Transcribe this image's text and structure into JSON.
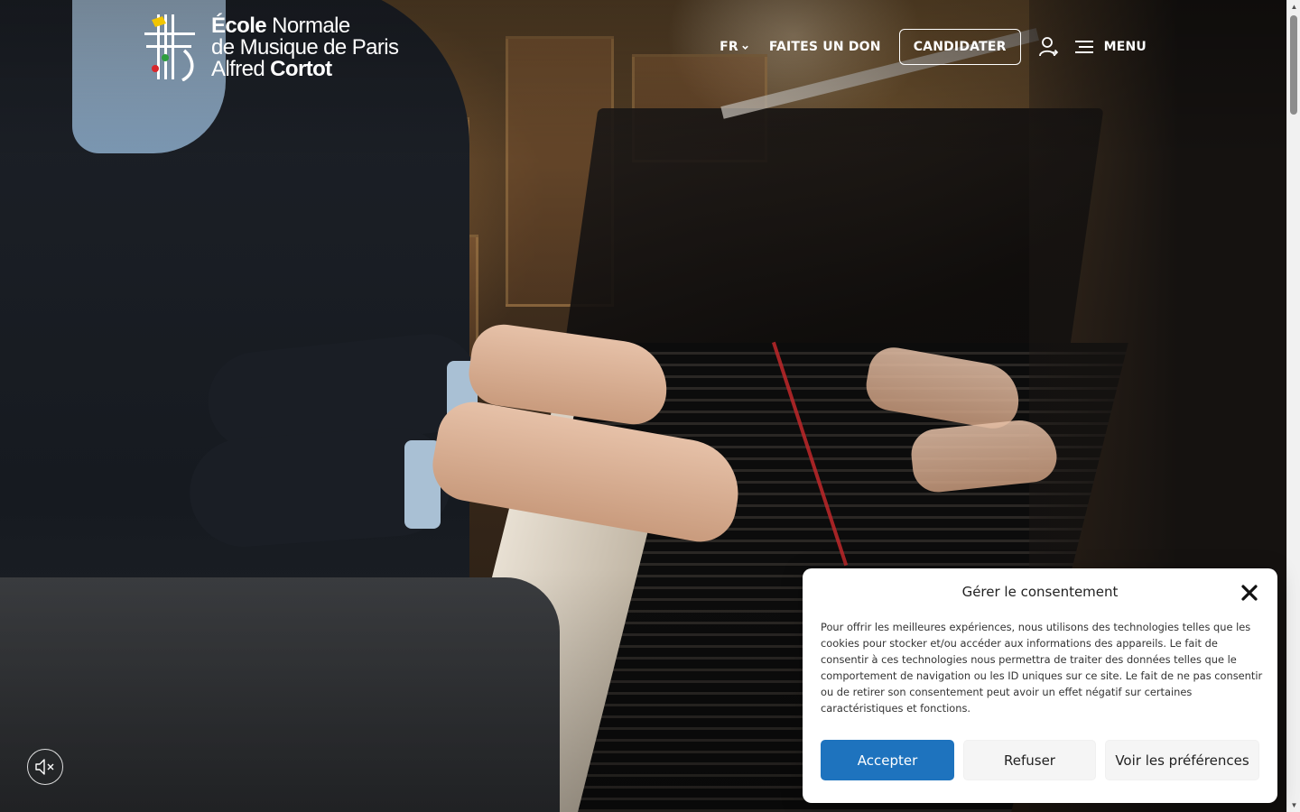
{
  "header": {
    "logo": {
      "line1_bold": "École",
      "line1_rest": " Normale",
      "line2": "de Musique de Paris",
      "line3_rest": "Alfred ",
      "line3_bold": "Cortot"
    },
    "nav": {
      "language": "FR",
      "donate": "FAITES UN DON",
      "apply": "CANDIDATER",
      "menu": "MENU"
    }
  },
  "consent": {
    "title": "Gérer le consentement",
    "body": "Pour offrir les meilleures expériences, nous utilisons des technologies telles que les cookies pour stocker et/ou accéder aux informations des appareils. Le fait de consentir à ces technologies nous permettra de traiter des données telles que le comportement de navigation ou les ID uniques sur ce site. Le fait de ne pas consentir ou de retirer son consentement peut avoir un effet négatif sur certaines caractéristiques et fonctions.",
    "accept": "Accepter",
    "refuse": "Refuser",
    "preferences": "Voir les préférences"
  },
  "colors": {
    "accept_blue": "#1e73be",
    "logo_yellow": "#f2c500",
    "logo_green": "#2e9e3e",
    "logo_red": "#d8262b"
  },
  "icons": {
    "language_chevron": "chevron-down-icon",
    "user": "user-login-icon",
    "menu": "hamburger-menu-icon",
    "close": "close-icon",
    "mute": "speaker-muted-icon"
  }
}
